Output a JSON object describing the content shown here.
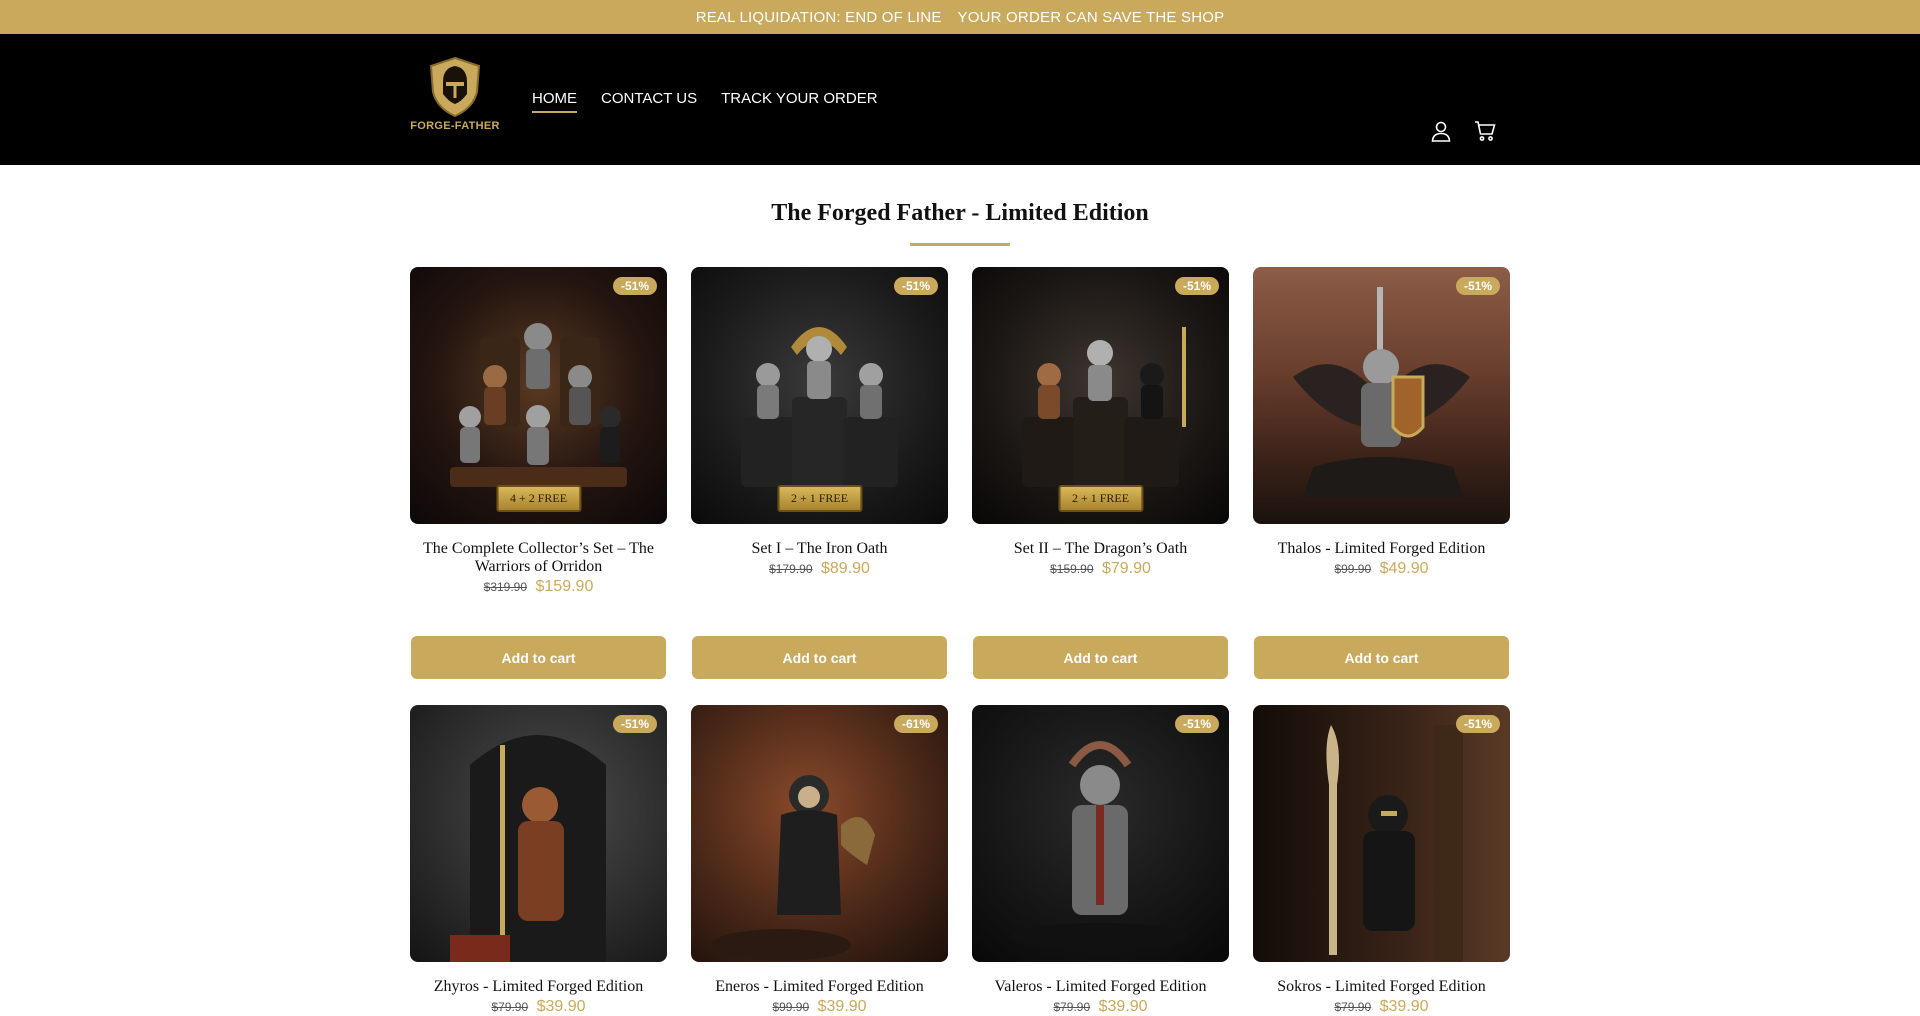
{
  "announcement": {
    "left": "REAL LIQUIDATION: END OF LINE",
    "right": "YOUR ORDER CAN SAVE THE SHOP"
  },
  "brand": {
    "logo_text": "FORGE-FATHER"
  },
  "nav": [
    {
      "label": "HOME",
      "active": true
    },
    {
      "label": "CONTACT US",
      "active": false
    },
    {
      "label": "TRACK YOUR ORDER",
      "active": false
    }
  ],
  "header_icons": [
    "user-icon",
    "cart-icon"
  ],
  "section": {
    "title": "The Forged Father - Limited Edition"
  },
  "products": [
    {
      "title": "The Complete Collector’s Set – The Warriors of Orridon",
      "old_price": "$319.90",
      "price": "$159.90",
      "badge": "-51%",
      "promo": "4 + 2 FREE",
      "button": "Add to cart"
    },
    {
      "title": "Set I – The Iron Oath",
      "old_price": "$179.90",
      "price": "$89.90",
      "badge": "-51%",
      "promo": "2 + 1 FREE",
      "button": "Add to cart"
    },
    {
      "title": "Set II – The Dragon’s Oath",
      "old_price": "$159.90",
      "price": "$79.90",
      "badge": "-51%",
      "promo": "2 + 1 FREE",
      "button": "Add to cart"
    },
    {
      "title": "Thalos - Limited Forged Edition",
      "old_price": "$99.90",
      "price": "$49.90",
      "badge": "-51%",
      "promo": "",
      "button": "Add to cart"
    },
    {
      "title": "Zhyros - Limited Forged Edition",
      "old_price": "$79.90",
      "price": "$39.90",
      "badge": "-51%",
      "promo": ""
    },
    {
      "title": "Eneros - Limited Forged Edition",
      "old_price": "$99.90",
      "price": "$39.90",
      "badge": "-61%",
      "promo": ""
    },
    {
      "title": "Valeros - Limited Forged Edition",
      "old_price": "$79.90",
      "price": "$39.90",
      "badge": "-51%",
      "promo": ""
    },
    {
      "title": "Sokros - Limited Forged Edition",
      "old_price": "$79.90",
      "price": "$39.90",
      "badge": "-51%",
      "promo": ""
    }
  ],
  "colors": {
    "accent": "#c9a95c",
    "header_bg": "#000000"
  }
}
